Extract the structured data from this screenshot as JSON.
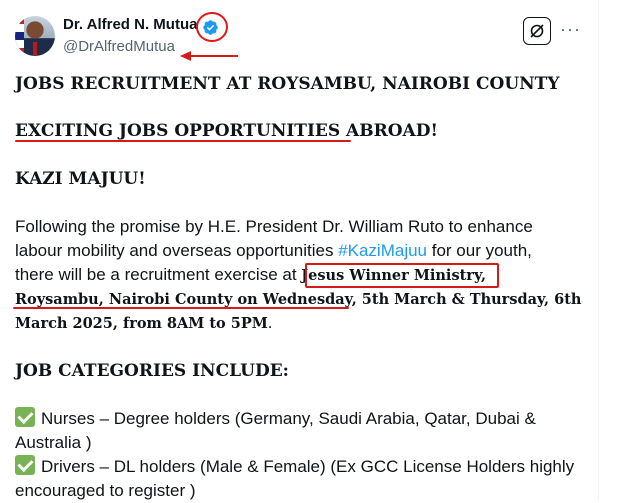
{
  "author": {
    "display_name": "Dr. Alfred N. Mutua",
    "handle": "@DrAlfredMutua",
    "verified": true
  },
  "icons": {
    "verified": "verified-badge-icon",
    "grok": "grok-icon",
    "more": "more-icon",
    "check": "check-mark-button-icon"
  },
  "colors": {
    "hashtag": "#1d9bf0",
    "verified": "#1d9bf0",
    "annotation": "#d61a1a",
    "check": "#77b255"
  },
  "post": {
    "line1": "JOBS RECRUITMENT AT ROYSAMBU, NAIROBI COUNTY",
    "line2": "EXCITING JOBS OPPORTUNITIES ABROAD!",
    "line3": "KAZI MAJUU!",
    "para_line1": "Following the promise by H.E. President Dr. William Ruto to enhance",
    "para_line2_a": "labour mobility and overseas opportunities ",
    "para_line2_hashtag": "#KaziMajuu",
    "para_line2_b": " for our youth,",
    "para_line3_a": "there will be a recruitment exercise at ",
    "para_line3_bold": "Jesus Winner Ministry",
    "para_line3_b": ",",
    "para_line4_bold": "Roysambu, Nairobi County on Wednesday",
    "para_line4_b": ", 5th March & Thursday, 6th",
    "para_line5": "March 2025, from 8AM to 5PM",
    "para_line5_end": ".",
    "categories_heading": "JOB CATEGORIES INCLUDE:",
    "cat1_line1": "Nurses – Degree holders (Germany, Saudi Arabia, Qatar, Dubai &",
    "cat1_line2": "Australia )",
    "cat2_line1": "Drivers – DL holders (Male & Female) (Ex GCC License Holders highly",
    "cat2_line2": "encouraged to register )"
  }
}
